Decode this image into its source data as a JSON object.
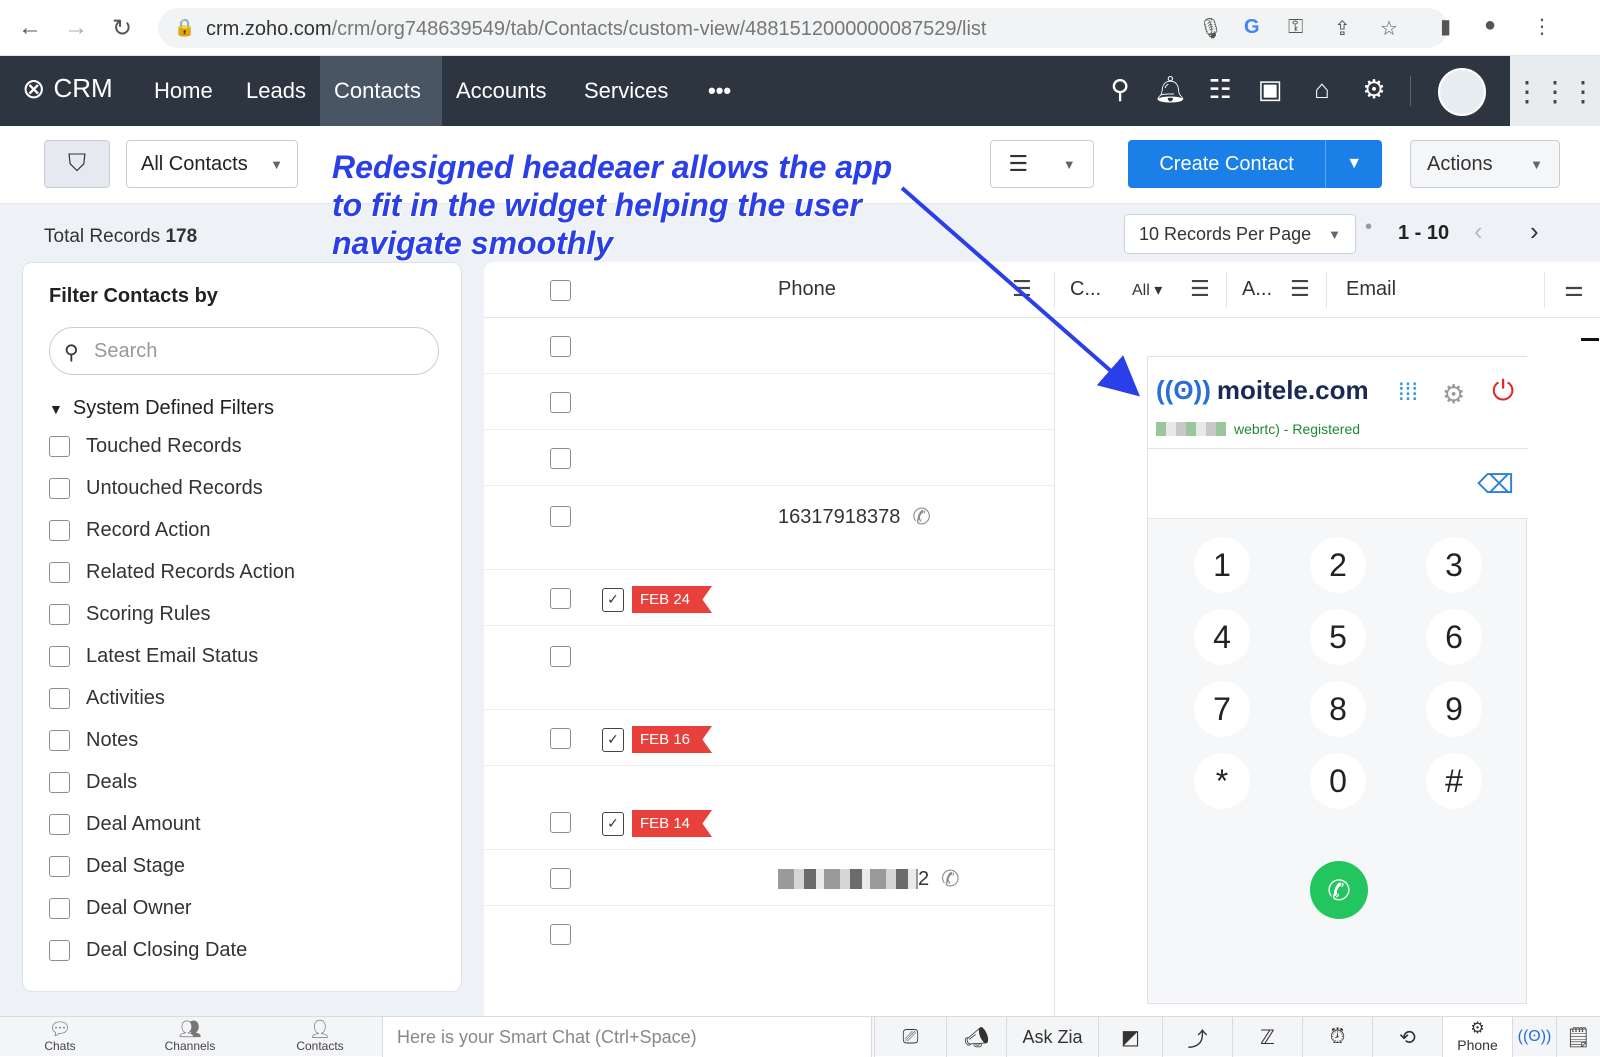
{
  "browser": {
    "url_host": "crm.zoho.com",
    "url_path": "/crm/org748639549/tab/Contacts/custom-view/4881512000000087529/list"
  },
  "topnav": {
    "brand": "CRM",
    "items": [
      "Home",
      "Leads",
      "Contacts",
      "Accounts",
      "Services"
    ],
    "active": "Contacts",
    "more": "•••"
  },
  "toolbar": {
    "view_name": "All Contacts",
    "create_label": "Create Contact",
    "actions_label": "Actions"
  },
  "records": {
    "total_label": "Total Records",
    "total_count": "178",
    "per_page": "10 Records Per Page",
    "range": "1 - 10"
  },
  "filter_panel": {
    "title": "Filter Contacts by",
    "search_placeholder": "Search",
    "section_title": "System Defined Filters",
    "items": [
      "Touched Records",
      "Untouched Records",
      "Record Action",
      "Related Records Action",
      "Scoring Rules",
      "Latest Email Status",
      "Activities",
      "Notes",
      "Deals",
      "Deal Amount",
      "Deal Stage",
      "Deal Owner",
      "Deal Closing Date"
    ]
  },
  "table": {
    "columns": {
      "phone": "Phone",
      "c": "C...",
      "all": "All",
      "a": "A...",
      "email": "Email"
    },
    "phone_row4": "16317918378",
    "phone_row9_suffix": "2",
    "tags": [
      "FEB 24",
      "FEB 16",
      "FEB 14"
    ]
  },
  "widget": {
    "brand": "moitele.com",
    "status": "webrtc) - Registered",
    "keys": [
      "1",
      "2",
      "3",
      "4",
      "5",
      "6",
      "7",
      "8",
      "9",
      "*",
      "0",
      "#"
    ]
  },
  "annotation": {
    "line1": "Redesigned headeaer allows the app",
    "line2": "to fit in the widget helping the user",
    "line3": "navigate smoothly",
    "color": "#2a3fe8"
  },
  "bottombar": {
    "chats": "Chats",
    "channels": "Channels",
    "contacts": "Contacts",
    "smart_chat_placeholder": "Here is your Smart Chat (Ctrl+Space)",
    "ask_zia": "Ask Zia",
    "phone": "Phone"
  }
}
